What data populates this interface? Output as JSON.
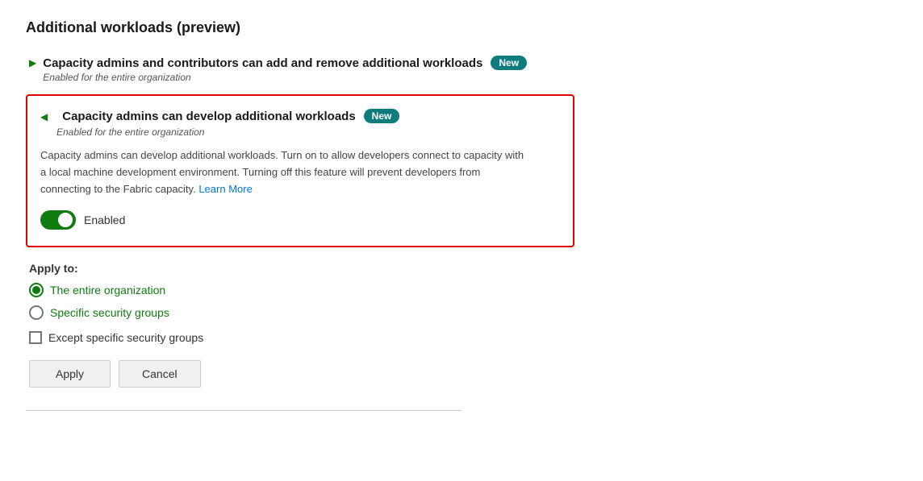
{
  "page": {
    "title": "Additional workloads (preview)"
  },
  "item1": {
    "title": "Capacity admins and contributors can add and remove additional workloads",
    "badge": "New",
    "subtitle": "Enabled for the entire organization"
  },
  "item2": {
    "title": "Capacity admins can develop additional workloads",
    "badge": "New",
    "subtitle": "Enabled for the entire organization",
    "description_part1": "Capacity admins can develop additional workloads. Turn on to allow developers connect to capacity with a local machine development environment. Turning off this feature will prevent developers from connecting to the Fabric capacity.",
    "learn_more_label": "Learn More",
    "toggle_label": "Enabled"
  },
  "apply_to": {
    "label": "Apply to:",
    "options": [
      {
        "label": "The entire organization",
        "selected": true
      },
      {
        "label": "Specific security groups",
        "selected": false
      }
    ],
    "except_label": "Except specific security groups"
  },
  "buttons": {
    "apply": "Apply",
    "cancel": "Cancel"
  }
}
